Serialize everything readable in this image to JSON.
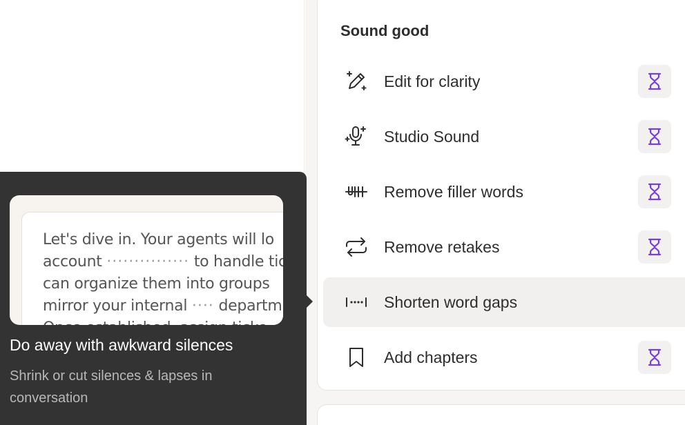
{
  "section": {
    "title": "Sound good"
  },
  "menu": [
    {
      "key": "edit-for-clarity",
      "label": "Edit for clarity",
      "icon": "magic-pencil-icon",
      "badge": "hourglass-icon"
    },
    {
      "key": "studio-sound",
      "label": "Studio Sound",
      "icon": "sparkle-microphone-icon",
      "badge": "hourglass-icon"
    },
    {
      "key": "remove-filler-words",
      "label": "Remove filler words",
      "icon": "strikethrough-text-icon",
      "badge": "hourglass-icon"
    },
    {
      "key": "remove-retakes",
      "label": "Remove retakes",
      "icon": "repeat-arrows-icon",
      "badge": "hourglass-icon"
    },
    {
      "key": "shorten-word-gaps",
      "label": "Shorten word gaps",
      "icon": "gap-dots-icon",
      "active": true
    },
    {
      "key": "add-chapters",
      "label": "Add chapters",
      "icon": "bookmark-icon",
      "badge": "hourglass-icon"
    }
  ],
  "tooltip": {
    "title": "Do away with awkward silences",
    "description": "Shrink or cut silences & lapses in conversation",
    "preview_lines": [
      {
        "before": "Let's dive in. Your agents will lo",
        "dots": "",
        "after": ""
      },
      {
        "before": "account ",
        "dots": "···············",
        "after": " to handle tic"
      },
      {
        "before": "can organize them into groups",
        "dots": "",
        "after": ""
      },
      {
        "before": "mirror your internal ",
        "dots": "····",
        "after": " departm"
      },
      {
        "before": "Once established, assign ticke",
        "dots": "",
        "after": ""
      }
    ]
  },
  "colors": {
    "accent": "#7a3fd6",
    "tooltip_bg": "#333333",
    "active_row": "#f1f0ef"
  }
}
